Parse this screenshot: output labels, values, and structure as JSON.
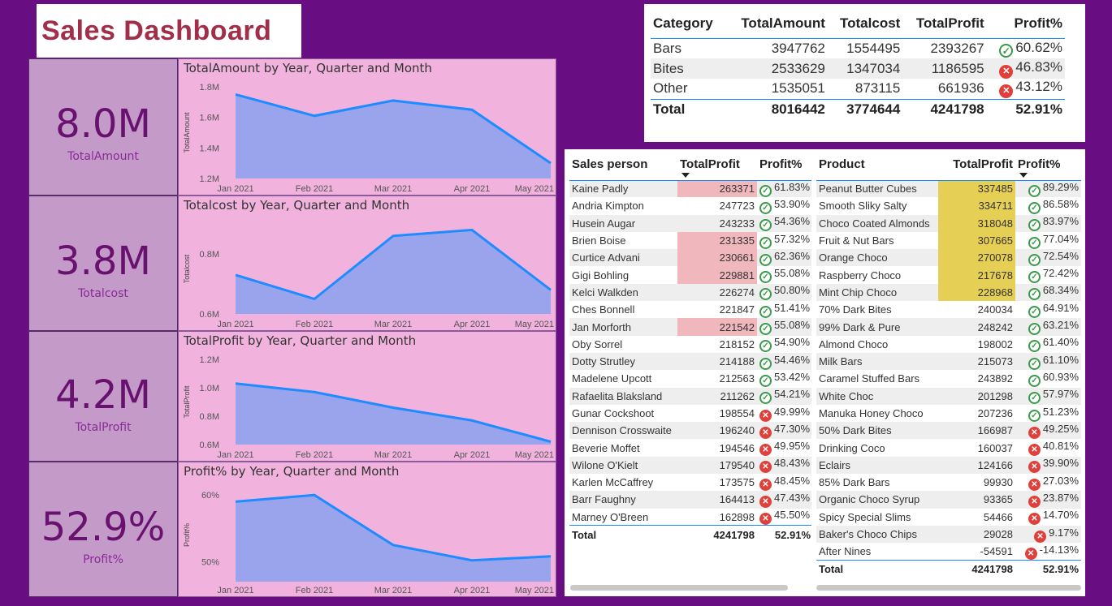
{
  "title": "Sales Dashboard",
  "kpis": [
    {
      "value": "8.0M",
      "label": "TotalAmount"
    },
    {
      "value": "3.8M",
      "label": "Totalcost"
    },
    {
      "value": "4.2M",
      "label": "TotalProfit"
    },
    {
      "value": "52.9%",
      "label": "Profit%"
    }
  ],
  "chart_data": [
    {
      "type": "area",
      "title": "TotalAmount by Year, Quarter and Month",
      "ylabel": "TotalAmount",
      "categories": [
        "Jan 2021",
        "Feb 2021",
        "Mar 2021",
        "Apr 2021",
        "May 2021"
      ],
      "values": [
        1.75,
        1.61,
        1.71,
        1.65,
        1.3
      ],
      "ylim": [
        1.2,
        1.8
      ],
      "yticks": [
        "1.8M",
        "1.6M",
        "1.4M",
        "1.2M"
      ]
    },
    {
      "type": "area",
      "title": "Totalcost by Year, Quarter and Month",
      "ylabel": "Totalcost",
      "categories": [
        "Jan 2021",
        "Feb 2021",
        "Mar 2021",
        "Apr 2021",
        "May 2021"
      ],
      "values": [
        0.73,
        0.65,
        0.86,
        0.88,
        0.68
      ],
      "ylim": [
        0.6,
        0.9
      ],
      "yticks": [
        "0.8M",
        "0.6M"
      ]
    },
    {
      "type": "area",
      "title": "TotalProfit by Year, Quarter and Month",
      "ylabel": "TotalProfit",
      "categories": [
        "Jan 2021",
        "Feb 2021",
        "Mar 2021",
        "Apr 2021",
        "May 2021"
      ],
      "values": [
        1.03,
        0.97,
        0.86,
        0.77,
        0.62
      ],
      "ylim": [
        0.6,
        1.2
      ],
      "yticks": [
        "1.2M",
        "1.0M",
        "0.8M",
        "0.6M"
      ]
    },
    {
      "type": "area",
      "title": "Profit% by Year, Quarter and Month",
      "ylabel": "Profit%",
      "categories": [
        "Jan 2021",
        "Feb 2021",
        "Mar 2021",
        "Apr 2021",
        "May 2021"
      ],
      "values": [
        59.0,
        60.0,
        52.5,
        50.2,
        50.8
      ],
      "ylim": [
        47,
        61
      ],
      "yticks": [
        "60%",
        "50%"
      ]
    }
  ],
  "category_table": {
    "headers": [
      "Category",
      "TotalAmount",
      "Totalcost",
      "TotalProfit",
      "Profit%"
    ],
    "rows": [
      {
        "cells": [
          "Bars",
          "3947762",
          "1554495",
          "2393267",
          "60.62%"
        ],
        "status": "ok"
      },
      {
        "cells": [
          "Bites",
          "2533629",
          "1347034",
          "1186595",
          "46.83%"
        ],
        "status": "bad"
      },
      {
        "cells": [
          "Other",
          "1535051",
          "873115",
          "661936",
          "43.12%"
        ],
        "status": "bad"
      }
    ],
    "total": [
      "Total",
      "8016442",
      "3774644",
      "4241798",
      "52.91%"
    ]
  },
  "sales_table": {
    "headers": [
      "Sales person",
      "TotalProfit",
      "Profit%"
    ],
    "rows": [
      {
        "cells": [
          "Kaine Padly",
          "263371",
          "61.83%"
        ],
        "status": "ok",
        "hl": true
      },
      {
        "cells": [
          "Andria Kimpton",
          "247723",
          "53.90%"
        ],
        "status": "ok",
        "hl": false
      },
      {
        "cells": [
          "Husein Augar",
          "243233",
          "54.36%"
        ],
        "status": "ok",
        "hl": false
      },
      {
        "cells": [
          "Brien Boise",
          "231335",
          "57.32%"
        ],
        "status": "ok",
        "hl": true
      },
      {
        "cells": [
          "Curtice Advani",
          "230661",
          "62.36%"
        ],
        "status": "ok",
        "hl": true
      },
      {
        "cells": [
          "Gigi Bohling",
          "229881",
          "55.08%"
        ],
        "status": "ok",
        "hl": true
      },
      {
        "cells": [
          "Kelci Walkden",
          "226274",
          "50.80%"
        ],
        "status": "ok",
        "hl": false
      },
      {
        "cells": [
          "Ches Bonnell",
          "221847",
          "51.41%"
        ],
        "status": "ok",
        "hl": false
      },
      {
        "cells": [
          "Jan Morforth",
          "221542",
          "55.08%"
        ],
        "status": "ok",
        "hl": true
      },
      {
        "cells": [
          "Oby Sorrel",
          "218152",
          "54.90%"
        ],
        "status": "ok",
        "hl": false
      },
      {
        "cells": [
          "Dotty Strutley",
          "214188",
          "54.46%"
        ],
        "status": "ok",
        "hl": false
      },
      {
        "cells": [
          "Madelene Upcott",
          "212563",
          "53.42%"
        ],
        "status": "ok",
        "hl": false
      },
      {
        "cells": [
          "Rafaelita Blaksland",
          "211262",
          "54.21%"
        ],
        "status": "ok",
        "hl": false
      },
      {
        "cells": [
          "Gunar Cockshoot",
          "198554",
          "49.99%"
        ],
        "status": "bad",
        "hl": false
      },
      {
        "cells": [
          "Dennison Crosswaite",
          "196240",
          "47.30%"
        ],
        "status": "bad",
        "hl": false
      },
      {
        "cells": [
          "Beverie Moffet",
          "194546",
          "49.95%"
        ],
        "status": "bad",
        "hl": false
      },
      {
        "cells": [
          "Wilone O'Kielt",
          "179540",
          "48.43%"
        ],
        "status": "bad",
        "hl": false
      },
      {
        "cells": [
          "Karlen McCaffrey",
          "173575",
          "48.45%"
        ],
        "status": "bad",
        "hl": false
      },
      {
        "cells": [
          "Barr Faughny",
          "164413",
          "47.43%"
        ],
        "status": "bad",
        "hl": false
      },
      {
        "cells": [
          "Marney O'Breen",
          "162898",
          "45.50%"
        ],
        "status": "bad",
        "hl": false
      }
    ],
    "total": [
      "Total",
      "4241798",
      "52.91%"
    ]
  },
  "product_table": {
    "headers": [
      "Product",
      "TotalProfit",
      "Profit%"
    ],
    "rows": [
      {
        "cells": [
          "Peanut Butter Cubes",
          "337485",
          "89.29%"
        ],
        "status": "ok",
        "hl": true
      },
      {
        "cells": [
          "Smooth Sliky Salty",
          "334711",
          "86.58%"
        ],
        "status": "ok",
        "hl": true
      },
      {
        "cells": [
          "Choco Coated Almonds",
          "318048",
          "83.97%"
        ],
        "status": "ok",
        "hl": true
      },
      {
        "cells": [
          "Fruit & Nut Bars",
          "307665",
          "77.04%"
        ],
        "status": "ok",
        "hl": true
      },
      {
        "cells": [
          "Orange Choco",
          "270078",
          "72.54%"
        ],
        "status": "ok",
        "hl": true
      },
      {
        "cells": [
          "Raspberry Choco",
          "217678",
          "72.42%"
        ],
        "status": "ok",
        "hl": true
      },
      {
        "cells": [
          "Mint Chip Choco",
          "228968",
          "68.34%"
        ],
        "status": "ok",
        "hl": true
      },
      {
        "cells": [
          "70% Dark Bites",
          "240034",
          "64.91%"
        ],
        "status": "ok",
        "hl": false
      },
      {
        "cells": [
          "99% Dark & Pure",
          "248242",
          "63.21%"
        ],
        "status": "ok",
        "hl": false
      },
      {
        "cells": [
          "Almond Choco",
          "198002",
          "61.40%"
        ],
        "status": "ok",
        "hl": false
      },
      {
        "cells": [
          "Milk Bars",
          "215073",
          "61.10%"
        ],
        "status": "ok",
        "hl": false
      },
      {
        "cells": [
          "Caramel Stuffed Bars",
          "243892",
          "60.93%"
        ],
        "status": "ok",
        "hl": false
      },
      {
        "cells": [
          "White Choc",
          "201298",
          "57.97%"
        ],
        "status": "ok",
        "hl": false
      },
      {
        "cells": [
          "Manuka Honey Choco",
          "207236",
          "51.23%"
        ],
        "status": "ok",
        "hl": false
      },
      {
        "cells": [
          "50% Dark Bites",
          "166987",
          "49.25%"
        ],
        "status": "bad",
        "hl": false
      },
      {
        "cells": [
          "Drinking Coco",
          "160037",
          "40.81%"
        ],
        "status": "bad",
        "hl": false
      },
      {
        "cells": [
          "Eclairs",
          "124166",
          "39.90%"
        ],
        "status": "bad",
        "hl": false
      },
      {
        "cells": [
          "85% Dark Bars",
          "99930",
          "27.03%"
        ],
        "status": "bad",
        "hl": false
      },
      {
        "cells": [
          "Organic Choco Syrup",
          "93365",
          "23.87%"
        ],
        "status": "bad",
        "hl": false
      },
      {
        "cells": [
          "Spicy Special Slims",
          "54466",
          "14.70%"
        ],
        "status": "bad",
        "hl": false
      },
      {
        "cells": [
          "Baker's Choco Chips",
          "29028",
          "9.17%"
        ],
        "status": "bad",
        "hl": false
      },
      {
        "cells": [
          "After Nines",
          "-54591",
          "-14.13%"
        ],
        "status": "bad",
        "hl": false
      }
    ],
    "total": [
      "Total",
      "4241798",
      "52.91%"
    ]
  },
  "colors": {
    "bg": "#690e82",
    "area": "#9aa4ec",
    "line": "#1e8cff",
    "ok": "#3a9a4a",
    "bad": "#e0403a",
    "pink_hl": "#f0b8bd",
    "yellow_hl": "#e5cf55"
  }
}
